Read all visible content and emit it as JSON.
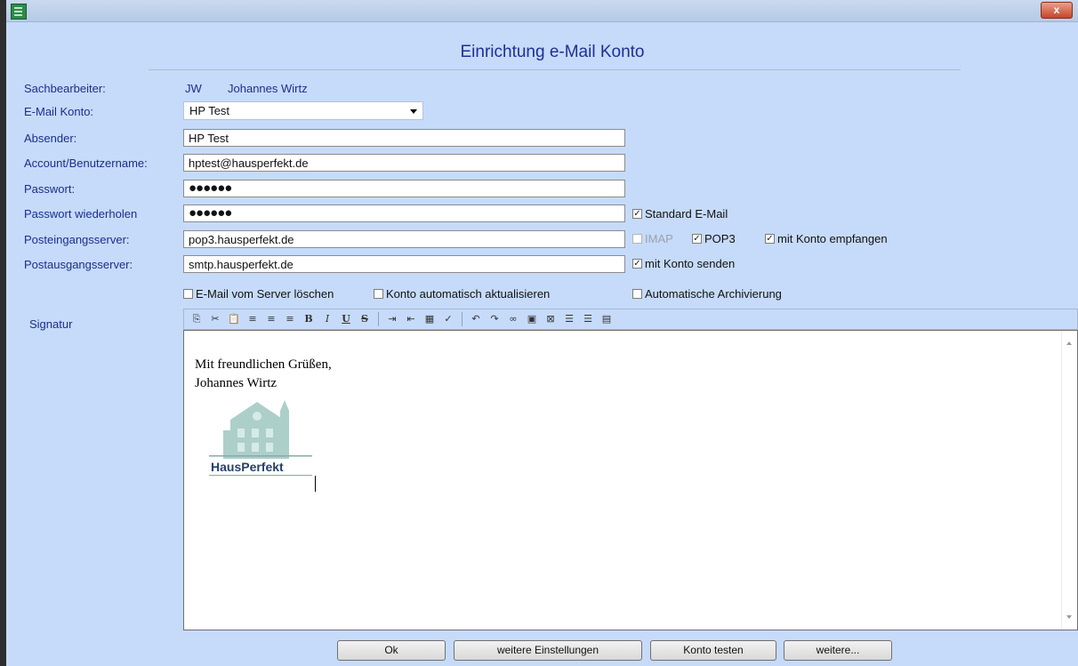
{
  "window": {
    "close_label": "x"
  },
  "heading": "Einrichtung e-Mail Konto",
  "labels": {
    "sachbearbeiter": "Sachbearbeiter:",
    "email_konto": "E-Mail Konto:",
    "absender": "Absender:",
    "account": "Account/Benutzername:",
    "passwort": "Passwort:",
    "passwort_wdh": "Passwort wiederholen",
    "posteingang": "Posteingangsserver:",
    "postausgang": "Postausgangsserver:",
    "signatur": "Signatur"
  },
  "sachbearbeiter": {
    "kuerzel": "JW",
    "name": "Johannes Wirtz"
  },
  "email_konto": {
    "selected": "HP Test"
  },
  "fields": {
    "absender": "HP Test",
    "account": "hptest@hausperfekt.de",
    "passwort": "●●●●●●",
    "passwort_wdh": "●●●●●●",
    "posteingang": "pop3.hausperfekt.de",
    "postausgang": "smtp.hausperfekt.de"
  },
  "checkboxes": {
    "standard_email": {
      "label": "Standard E-Mail",
      "checked": true
    },
    "imap": {
      "label": "IMAP",
      "checked": false
    },
    "pop3": {
      "label": "POP3",
      "checked": true
    },
    "mit_konto_empfangen": {
      "label": "mit Konto empfangen",
      "checked": true
    },
    "mit_konto_senden": {
      "label": "mit Konto senden",
      "checked": true
    },
    "vom_server_loeschen": {
      "label": "E-Mail vom Server löschen",
      "checked": false
    },
    "auto_aktualisieren": {
      "label": "Konto automatisch aktualisieren",
      "checked": false
    },
    "auto_archivierung": {
      "label": "Automatische Archivierung",
      "checked": false
    }
  },
  "signature": {
    "line1": "Mit freundlichen Grüßen,",
    "line2": "Johannes Wirtz",
    "logo_text": "HausPerfekt"
  },
  "toolbar_icons": [
    "copy-icon",
    "cut-icon",
    "paste-icon",
    "align-left-icon",
    "align-center-icon",
    "align-right-icon",
    "bold-icon",
    "italic-icon",
    "underline-icon",
    "strikethrough-icon",
    "indent-icon",
    "outdent-icon",
    "table-icon",
    "spellcheck-icon",
    "undo-icon",
    "redo-icon",
    "link-icon",
    "image-icon",
    "select-all-icon",
    "numbered-list-icon",
    "bullet-list-icon",
    "horizontal-rule-icon"
  ],
  "buttons": {
    "ok": "Ok",
    "weitere_einstellungen": "weitere Einstellungen",
    "konto_testen": "Konto testen",
    "weitere": "weitere..."
  },
  "check_glyph": "✓"
}
